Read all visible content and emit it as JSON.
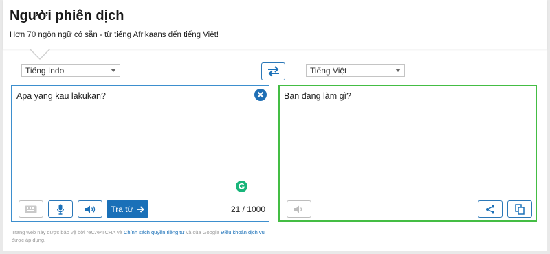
{
  "header": {
    "title": "Người phiên dịch",
    "subtitle": "Hơn 70 ngôn ngữ có sẵn - từ tiếng Afrikaans đến tiếng Việt!"
  },
  "languages": {
    "source": "Tiếng Indo",
    "target": "Tiếng Việt"
  },
  "source_panel": {
    "text": "Apa yang kau lakukan?",
    "translate_label": "Tra từ",
    "counter": "21 / 1000"
  },
  "target_panel": {
    "text": "Bạn đang làm gì?"
  },
  "footer": {
    "prefix": "Trang web này được bảo vệ bởi reCAPTCHA và ",
    "privacy": "Chính sách quyền riêng tư",
    "middle": " và của Google ",
    "terms": "Điều khoản dịch vụ",
    "suffix": " được áp dụng."
  },
  "colors": {
    "accent_blue": "#1a70b8",
    "source_border": "#3d8fce",
    "target_border": "#44bd44",
    "grammarly_green": "#18b57a"
  },
  "icons": [
    "swap-icon",
    "clear-icon",
    "keyboard-icon",
    "microphone-icon",
    "speaker-icon",
    "arrow-right-icon",
    "share-icon",
    "copy-icon",
    "grammarly-icon"
  ]
}
